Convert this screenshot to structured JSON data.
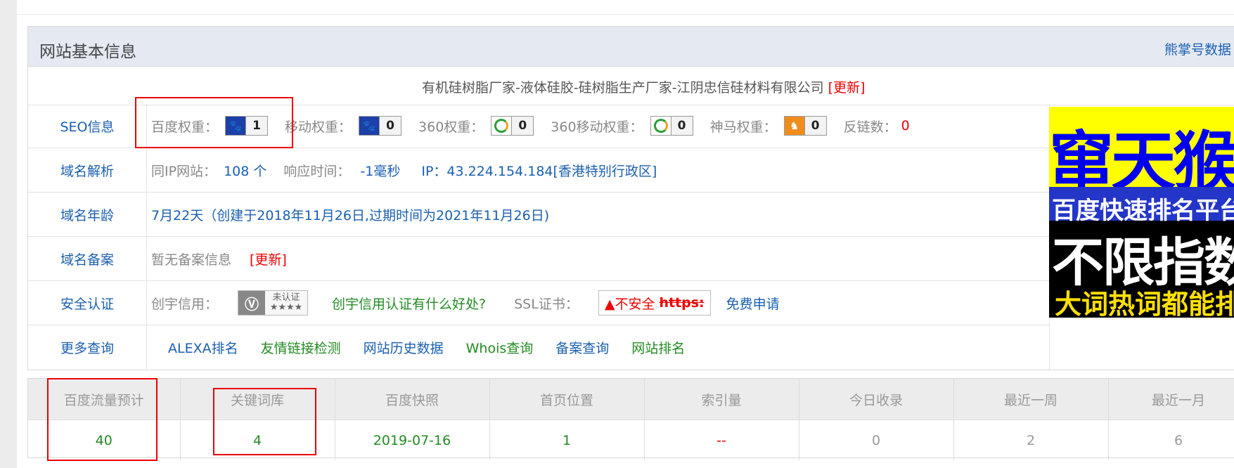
{
  "panel": {
    "title": "网站基本信息",
    "header_link": "熊掌号数据",
    "site_title": "有机硅树脂厂家-液体硅胶-硅树脂生产厂家-江阴忠信硅材料有限公司",
    "site_update": "[更新]"
  },
  "seo": {
    "label": "SEO信息",
    "baidu_label": "百度权重：",
    "baidu_value": "1",
    "mobile_label": "移动权重：",
    "mobile_value": "0",
    "s360_label": "360权重：",
    "s360_value": "0",
    "s360m_label": "360移动权重：",
    "s360m_value": "0",
    "shenma_label": "神马权重：",
    "shenma_value": "0",
    "backlink_label": "反链数：",
    "backlink_value": "0"
  },
  "dns": {
    "label": "域名解析",
    "same_ip_label": "同IP网站：",
    "same_ip_value": "108 个",
    "resp_label": "响应时间：",
    "resp_value": "-1毫秒",
    "ip": "IP：43.224.154.184[香港特别行政区]"
  },
  "age": {
    "label": "域名年龄",
    "value": "7月22天（创建于2018年11月26日,过期时间为2021年11月26日)"
  },
  "icp": {
    "label": "域名备案",
    "value": "暂无备案信息",
    "update": "[更新]"
  },
  "security": {
    "label": "安全认证",
    "cred_label": "创宇信用：",
    "cert_text": "未认证",
    "cert_stars": "★★★★",
    "cred_link": "创宇信用认证有什么好处?",
    "ssl_label": "SSL证书：",
    "ssl_warn": "▲不安全",
    "ssl_https": "https:",
    "ssl_apply": "免费申请"
  },
  "more": {
    "label": "更多查询",
    "links": [
      "ALEXA排名",
      "友情链接检测",
      "网站历史数据",
      "Whois查询",
      "备案查询",
      "网站排名"
    ]
  },
  "ad": {
    "line1": "窜天猴",
    "line2": "百度快速排名平台",
    "line3": "不限指数",
    "line4": "大词热词都能排"
  },
  "stats": {
    "headers": [
      "百度流量预计",
      "",
      "关键词库",
      "百度快照",
      "首页位置",
      "索引量",
      "今日收录",
      "最近一周",
      "最近一月"
    ],
    "values": [
      "40",
      "",
      "4",
      "2019-07-16",
      "1",
      "--",
      "0",
      "2",
      "6"
    ]
  },
  "colors": {
    "link": "#1a5fb0",
    "green": "#228b22",
    "red": "#e00000",
    "header_bg": "#e5e9f2"
  }
}
